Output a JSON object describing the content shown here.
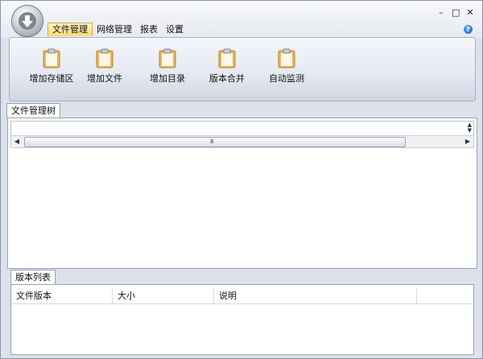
{
  "titlebar": {
    "controls": {
      "minimize": "–",
      "maximize": "□",
      "close": "✕"
    },
    "help": "?"
  },
  "tabs": [
    "文件管理",
    "网络管理",
    "报表",
    "设置"
  ],
  "ribbon": {
    "buttons": [
      "增加存储区",
      "增加文件",
      "增加目录",
      "版本合并",
      "自动监测"
    ]
  },
  "tree_panel": {
    "tab": "文件管理树"
  },
  "list_panel": {
    "tab": "版本列表",
    "columns": [
      "文件版本",
      "大小",
      "说明",
      ""
    ]
  },
  "colors": {
    "active_tab": "#ffd977",
    "ribbon_bg": "#e4e8f2",
    "frame": "#9aa3b3"
  }
}
